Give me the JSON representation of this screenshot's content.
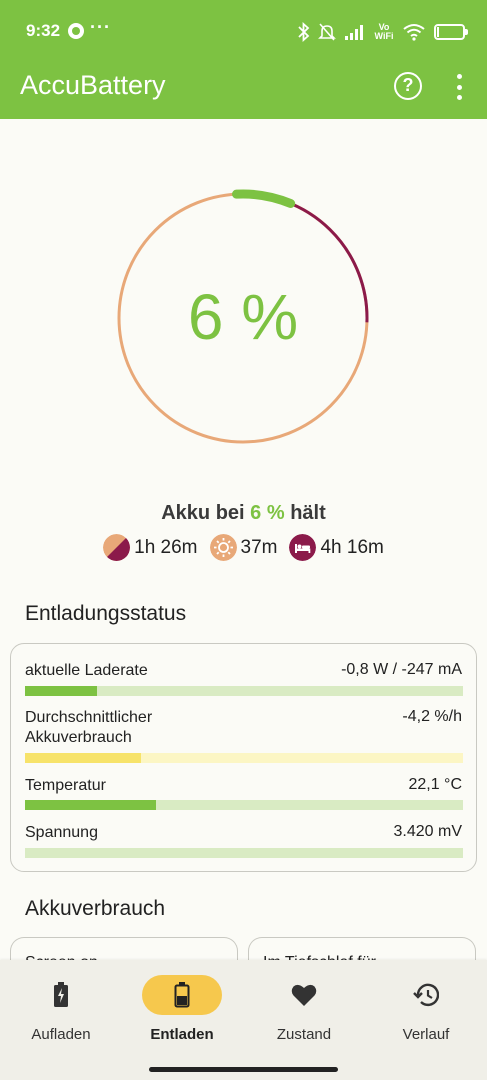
{
  "status_bar": {
    "time": "9:32",
    "extra": "···",
    "network_label_top": "Vo",
    "network_label_bottom": "WiFi"
  },
  "app_bar": {
    "title": "AccuBattery",
    "help_icon": "help-circle-icon",
    "more_icon": "more-vertical-icon"
  },
  "gauge": {
    "percent_text": "6 %",
    "level_fraction": 0.06,
    "ring_color": "#e8a878",
    "fill_color": "#7dc242",
    "range_color": "#8b1a4a"
  },
  "summary": {
    "prefix": "Akku bei",
    "percent": "6 %",
    "suffix": "hält",
    "times": [
      {
        "icon": "mixed-usage-icon",
        "value": "1h 26m"
      },
      {
        "icon": "screen-on-icon",
        "value": "37m"
      },
      {
        "icon": "sleep-icon",
        "value": "4h 16m"
      }
    ]
  },
  "discharge": {
    "title": "Entladungsstatus",
    "rows": [
      {
        "label": "aktuelle Laderate",
        "value": "-0,8 W / -247 mA",
        "fill": 0.165,
        "color": "#7dc242"
      },
      {
        "label": "Durchschnittlicher Akkuverbrauch",
        "value": "-4,2 %/h",
        "fill": 0.265,
        "color": "#f7e36a"
      },
      {
        "label": "Temperatur",
        "value": "22,1 °C",
        "fill": 0.3,
        "color": "#7dc242"
      },
      {
        "label": "Spannung",
        "value": "3.420 mV",
        "fill": 0,
        "color": "#7dc242"
      }
    ]
  },
  "usage": {
    "title": "Akkuverbrauch",
    "cards": [
      "Screen on",
      "Im Tiefschlaf für"
    ]
  },
  "nav": [
    {
      "label": "Aufladen",
      "icon": "battery-charging-icon",
      "active": false
    },
    {
      "label": "Entladen",
      "icon": "battery-discharge-icon",
      "active": true
    },
    {
      "label": "Zustand",
      "icon": "heart-icon",
      "active": false
    },
    {
      "label": "Verlauf",
      "icon": "history-icon",
      "active": false
    }
  ]
}
